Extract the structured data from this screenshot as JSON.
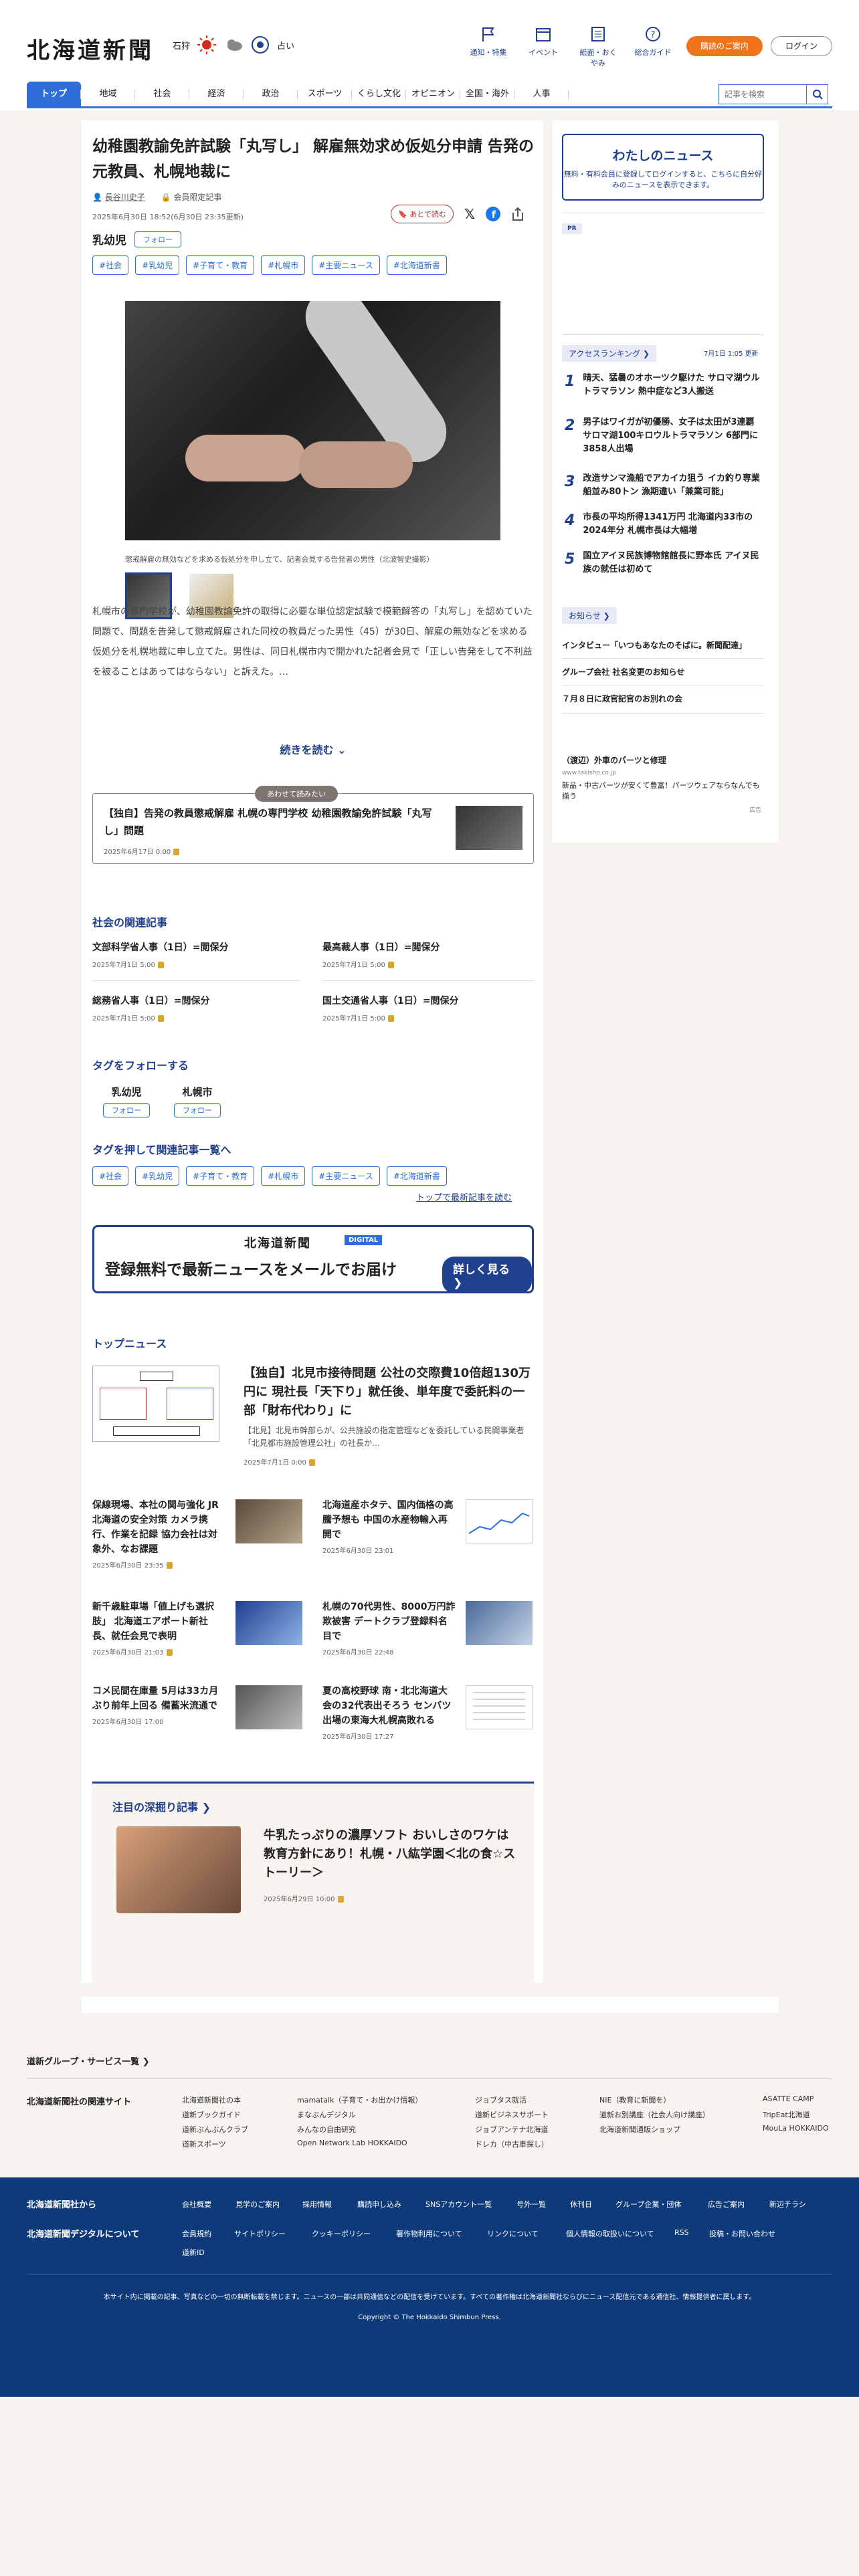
{
  "header": {
    "logo": "北海道新聞",
    "weather_city": "石狩",
    "fortune": "占い",
    "top_links": [
      "通知・特集",
      "イベント",
      "紙面・おくやみ",
      "総合ガイド"
    ],
    "signup": "購読のご案内",
    "login": "ログイン",
    "search_placeholder": "記事を検索"
  },
  "nav": [
    "トップ",
    "地域",
    "社会",
    "経済",
    "政治",
    "スポーツ",
    "くらし文化",
    "オピニオン",
    "全国・海外",
    "人事"
  ],
  "article": {
    "title": "幼稚園教諭免許試験「丸写し」 解雇無効求め仮処分申請 告発の元教員、札幌地裁に",
    "author": "長谷川史子",
    "member_label": "会員限定記事",
    "dates": "2025年6月30日 18:52(6月30日 23:35更新)",
    "save_later": "あとで読む",
    "person": "乳幼児",
    "follow": "フォロー",
    "tags": [
      "#社会",
      "#乳幼児",
      "#子育て・教育",
      "#札幌市",
      "#主要ニュース",
      "#北海道新書"
    ],
    "caption": "懲戒解雇の無効などを求める仮処分を申し立て、記者会見する告発者の男性（北波智史撮影）",
    "body": "札幌市の専門学校が、幼稚園教諭免許の取得に必要な単位認定試験で模範解答の「丸写し」を認めていた問題で、問題を告発して懲戒解雇された同校の教員だった男性（45）が30日、解雇の無効などを求める仮処分を札幌地裁に申し立てた。男性は、同日札幌市内で開かれた記者会見で「正しい告発をして不利益を被ることはあってはならない」と訴えた。…",
    "read_more": "続きを読む"
  },
  "recommend": {
    "label": "あわせて読みたい",
    "title": "【独自】告発の教員懲戒解雇 札幌の専門学校 幼稚園教諭免許試験「丸写し」問題",
    "date": "2025年6月17日 0:00"
  },
  "related": {
    "heading": "社会の関連記事",
    "items": [
      {
        "title": "文部科学省人事（1日）=閲保分",
        "date": "2025年7月1日 5:00"
      },
      {
        "title": "最高裁人事（1日）=閲保分",
        "date": "2025年7月1日 5:00"
      },
      {
        "title": "総務省人事（1日）=閲保分",
        "date": "2025年7月1日 5:00"
      },
      {
        "title": "国土交通省人事（1日）=閲保分",
        "date": "2025年7月1日 5:00"
      }
    ]
  },
  "follow_tags": {
    "heading": "タグをフォローする",
    "items": [
      {
        "name": "乳幼児",
        "btn": "フォロー"
      },
      {
        "name": "札幌市",
        "btn": "フォロー"
      }
    ]
  },
  "tag_list": {
    "heading": "タグを押して関連記事一覧へ",
    "tags": [
      "#社会",
      "#乳幼児",
      "#子育て・教育",
      "#札幌市",
      "#主要ニュース",
      "#北海道新書"
    ],
    "top_link": "トップで最新記事を読む"
  },
  "banner": {
    "logo": "北海道新聞",
    "badge": "DIGITAL",
    "text": "登録無料で最新ニュースをメールでお届け",
    "button": "詳しく見る ❯"
  },
  "top_news": {
    "heading": "トップニュース",
    "lead": {
      "title": "【独自】北見市接待問題 公社の交際費10倍超130万円に 現社長「天下り」就任後、単年度で委託料の一部「財布代わり」に",
      "summary": "【北見】北見市幹部らが、公共施設の指定管理などを委託している民間事業者「北見都市施設管理公社」の社長か…",
      "date": "2025年7月1日 0:00"
    },
    "items": [
      {
        "title": "保線現場、本社の関与強化 JR北海道の安全対策 カメラ携行、作業を記録 協力会社は対象外、なお課題",
        "date": "2025年6月30日 23:35"
      },
      {
        "title": "北海道産ホタテ、国内価格の高騰予想も 中国の水産物輸入再開で",
        "date": "2025年6月30日 23:01"
      },
      {
        "title": "新千歳駐車場「値上げも選択肢」 北海道エアポート新社長、就任会見で表明",
        "date": "2025年6月30日 21:03"
      },
      {
        "title": "札幌の70代男性、8000万円詐欺被害 デートクラブ登録料名目で",
        "date": "2025年6月30日 22:48"
      },
      {
        "title": "コメ民間在庫量 5月は33カ月ぶり前年上回る 備蓄米流通で",
        "date": "2025年6月30日 17:00"
      },
      {
        "title": "夏の高校野球 南・北北海道大会の32代表出そろう センバツ出場の東海大札幌高敗れる",
        "date": "2025年6月30日 17:27"
      }
    ]
  },
  "feature": {
    "heading": "注目の深掘り記事 ❯",
    "title": "牛乳たっぷりの濃厚ソフト おいしさのワケは教育方針にあり！札幌・八紘学園＜北の食☆ストーリー＞",
    "date": "2025年6月29日 10:00"
  },
  "sidebar": {
    "mynews_title": "わたしのニュース",
    "mynews_text": "無料・有料会員に登録してログインすると、こちらに自分好みのニュースを表示できます。",
    "pr": "PR",
    "ranking_label": "アクセスランキング ❯",
    "ranking_time": "7月1日 1:05 更新",
    "ranking": [
      "晴天、猛暑のオホーツク駆けた サロマ湖ウルトラマラソン 熱中症など3人搬送",
      "男子はワイガが初優勝、女子は太田が3連覇 サロマ湖100キロウルトラマラソン 6部門に3858人出場",
      "改造サンマ漁船でアカイカ狙う イカ釣り専業船並み80トン 漁期違い「兼業可能」",
      "市長の平均所得1341万円 北海道内33市の2024年分 札幌市長は大幅増",
      "国立アイヌ民族博物館館長に野本氏 アイヌ民族の就任は初めて"
    ],
    "notice_label": "お知らせ ❯",
    "notices": [
      "インタビュー「いつもあなたのそばに。新聞配達」",
      "グループ会社 社名変更のお知らせ",
      "７月８日に政官記官のお別れの会"
    ],
    "ad_title": "（渡辺）外車のパーツと修理",
    "ad_url": "www.takisho.co.jp",
    "ad_text": "新品・中古パーツが安くて豊富！パーツウェアならなんでも揃う",
    "ad_label": "広告"
  },
  "footer": {
    "group_label": "道新グループ・サービス一覧 ❯",
    "related_sites_label": "北海道新聞社の関連サイト",
    "sites": [
      "北海道新聞社の本",
      "mamatalk（子育て・お出かけ情報）",
      "ジョブタス就活",
      "NIE（教育に新聞を）",
      "ASATTE CAMP",
      "道新ブックガイド",
      "まなぶんデジタル",
      "道新ビジネスサポート",
      "道新お別講座（社会人向け講座）",
      "TripEat北海道",
      "道新ぶんぶんクラブ",
      "みんなの自由研究",
      "ジョブアンテナ北海道",
      "北海道新聞通販ショップ",
      "MouLa HOKKAIDO",
      "道新スポーツ",
      "Open Network Lab HOKKAIDO",
      "ドレカ（中古車探し）"
    ],
    "from_company": "北海道新聞社から",
    "about_digital": "北海道新聞デジタルについて",
    "company_links": [
      "会社概要",
      "見学のご案内",
      "採用情報",
      "購読申し込み",
      "SNSアカウント一覧",
      "号外一覧",
      "休刊日",
      "グループ企業・団体",
      "広告ご案内",
      "新辺チラシ"
    ],
    "digital_links": [
      "会員規約",
      "サイトポリシー",
      "クッキーポリシー",
      "著作物利用について",
      "リンクについて",
      "個人情報の取扱いについて",
      "RSS",
      "投稿・お問い合わせ",
      "道新ID"
    ],
    "disclaimer": "本サイト内に掲載の記事、写真などの一切の無断転載を禁じます。ニュースの一部は共同通信などの配信を受けています。すべての著作権は北海道新聞社ならびにニュース配信元である通信社、情報提供者に属します。",
    "copyright": "Copyright © The Hokkaido Shimbun Press."
  }
}
